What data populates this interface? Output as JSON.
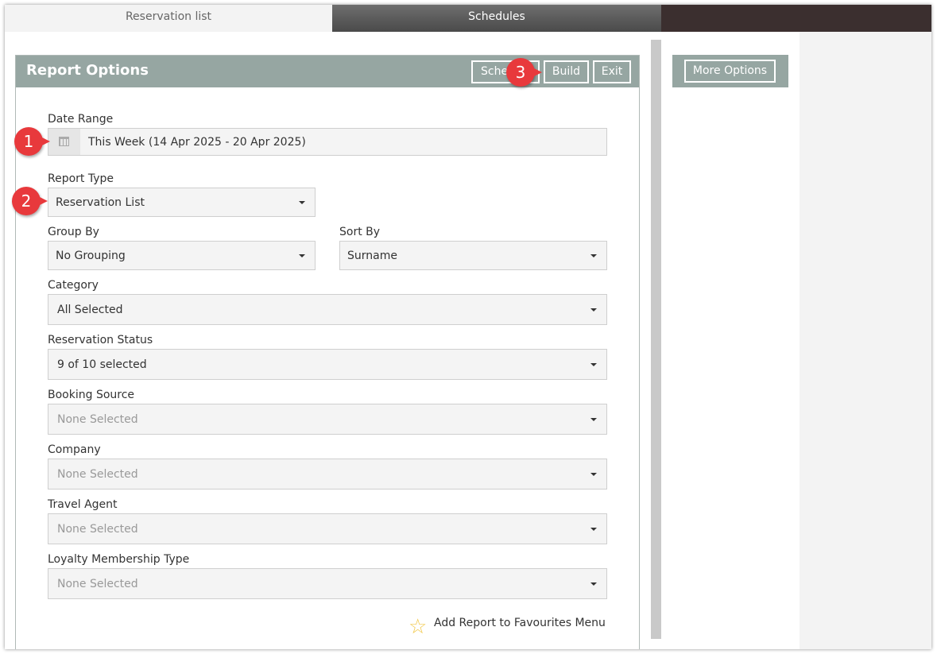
{
  "tabs": {
    "reservation_list": "Reservation list",
    "schedules": "Schedules"
  },
  "panel": {
    "title": "Report Options",
    "schedule_label": "Schedule",
    "build_label": "Build",
    "exit_label": "Exit"
  },
  "side": {
    "more_options_label": "More Options"
  },
  "form": {
    "date_range_label": "Date Range",
    "date_range_value": "This Week (14 Apr 2025 - 20 Apr 2025)",
    "report_type_label": "Report Type",
    "report_type_value": "Reservation List",
    "group_by_label": "Group By",
    "group_by_value": "No Grouping",
    "sort_by_label": "Sort By",
    "sort_by_value": "Surname",
    "category_label": "Category",
    "category_value": "All Selected",
    "reservation_status_label": "Reservation Status",
    "reservation_status_value": "9 of 10 selected",
    "booking_source_label": "Booking Source",
    "booking_source_value": "None Selected",
    "company_label": "Company",
    "company_value": "None Selected",
    "travel_agent_label": "Travel Agent",
    "travel_agent_value": "None Selected",
    "loyalty_label": "Loyalty Membership Type",
    "loyalty_value": "None Selected",
    "favourites_label": "Add Report to Favourites Menu"
  },
  "callouts": {
    "one": "1",
    "two": "2",
    "three": "3"
  },
  "colors": {
    "header": "#96a6a2",
    "schedules_tab": "#4a4a4a",
    "dark_strip": "#3b2f2f",
    "callout": "#e8393c"
  },
  "icons": [
    "calendar-icon",
    "chevron-down-icon",
    "star-icon"
  ]
}
